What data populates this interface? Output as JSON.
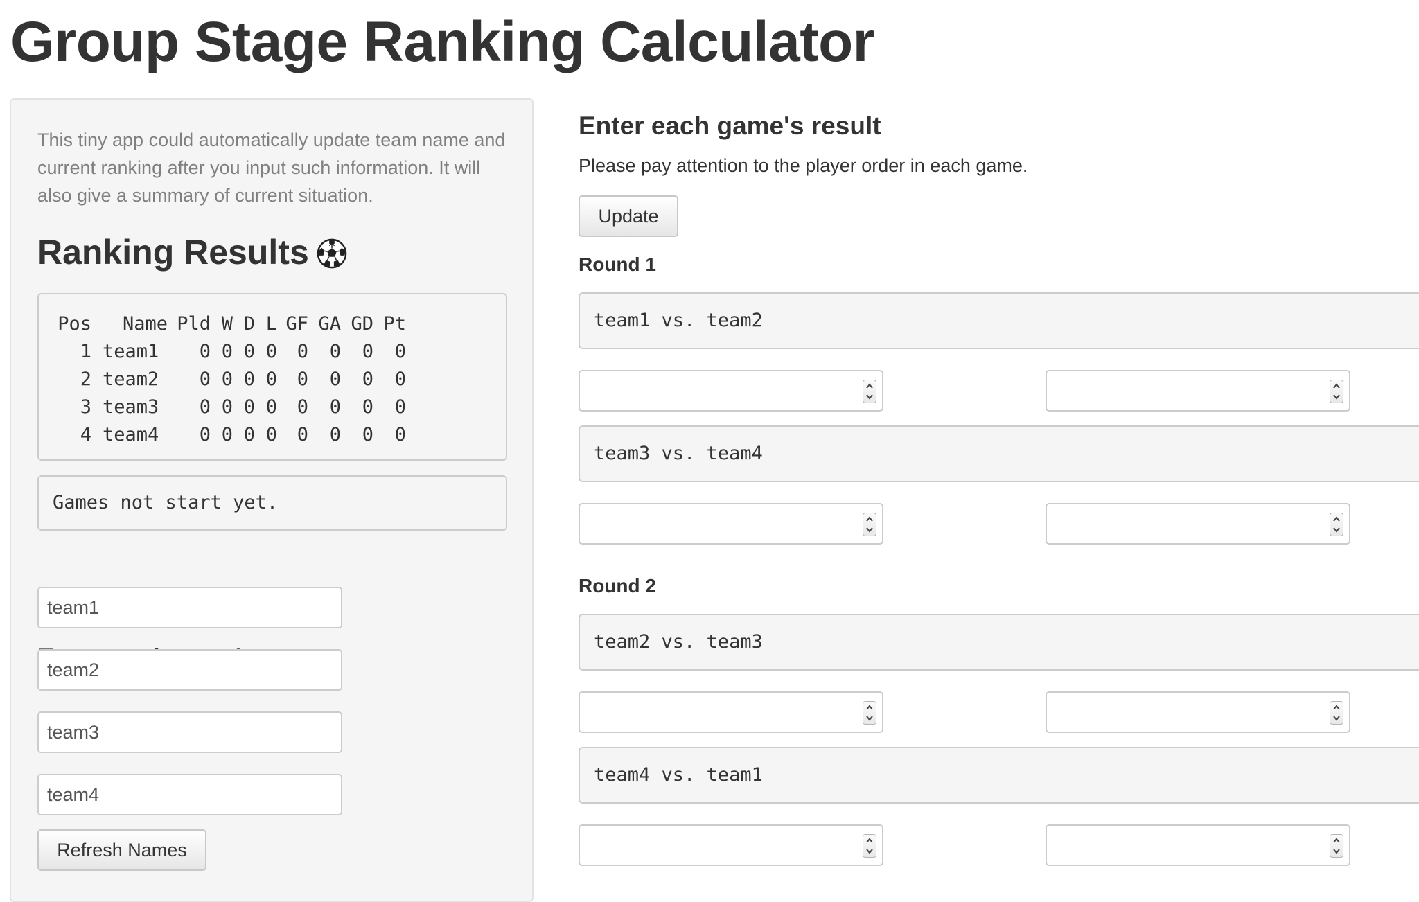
{
  "page": {
    "title": "Group Stage Ranking Calculator"
  },
  "sidebar": {
    "intro": "This tiny app could automatically update team name and current ranking after you input such information. It will also give a summary of current situation.",
    "ranking_title": "Ranking Results",
    "ranking_icon": "soccer-ball-icon",
    "ranking_table": {
      "columns": [
        "Pos",
        "Name",
        "Pld",
        "W",
        "D",
        "L",
        "GF",
        "GA",
        "GD",
        "Pt"
      ],
      "rows": [
        [
          "1",
          "team1",
          "0",
          "0",
          "0",
          "0",
          "0",
          "0",
          "0",
          "0"
        ],
        [
          "2",
          "team2",
          "0",
          "0",
          "0",
          "0",
          "0",
          "0",
          "0",
          "0"
        ],
        [
          "3",
          "team3",
          "0",
          "0",
          "0",
          "0",
          "0",
          "0",
          "0",
          "0"
        ],
        [
          "4",
          "team4",
          "0",
          "0",
          "0",
          "0",
          "0",
          "0",
          "0",
          "0"
        ]
      ]
    },
    "summary": "Games not start yet.",
    "names_title": "Enter each team's name",
    "team_names": [
      "team1",
      "team2",
      "team3",
      "team4"
    ],
    "refresh_label": "Refresh Names"
  },
  "main": {
    "title": "Enter each game's result",
    "notice": "Please pay attention to the player order in each game.",
    "update_label": "Update",
    "rounds": [
      {
        "label": "Round 1",
        "matches": [
          {
            "text": "team1 vs. team2",
            "home_score": "",
            "away_score": ""
          },
          {
            "text": "team3 vs. team4",
            "home_score": "",
            "away_score": ""
          }
        ]
      },
      {
        "label": "Round 2",
        "matches": [
          {
            "text": "team2 vs. team3",
            "home_score": "",
            "away_score": ""
          },
          {
            "text": "team4 vs. team1",
            "home_score": "",
            "away_score": ""
          }
        ]
      }
    ]
  }
}
